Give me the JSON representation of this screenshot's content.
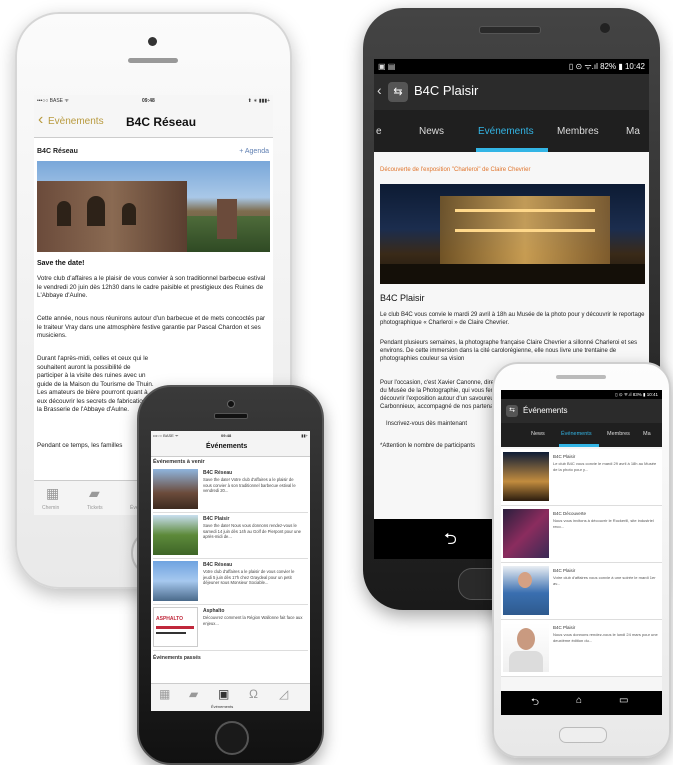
{
  "iphone_main": {
    "status": {
      "carrier": "•••○○ BASE ᯤ",
      "time": "09:48",
      "battery": "⬆ ∗ ▮▮▮+"
    },
    "nav": {
      "back_label": "Evènements",
      "title": "B4C Réseau"
    },
    "header": {
      "org": "B4C Réseau",
      "agenda": "+ Agenda"
    },
    "article": {
      "heading": "Save the date!",
      "p1": "Votre club d'affaires a le plaisir de vous convier à son traditionnel barbecue estival le vendredi 20 juin dès 12h30 dans le cadre paisible et prestigieux des Ruines de L'Abbaye d'Aulne.",
      "p2": "Cette année, nous nous réunirons autour d'un barbecue et de mets concoctés par le traiteur Vray dans une atmosphère festive garantie par Pascal Chardon et ses musiciens.",
      "p3": "Durant l'après-midi, celles et ceux qui le souhaitent auront la possibilité de participer à la visite des ruines avec un guide de la Maison du Tourisme de Thuin. Les amateurs de bière pourront quant à eux découvrir les secrets de fabrication de la Brasserie de l'Abbaye d'Aulne.",
      "p4": "Pendant ce temps, les familles"
    },
    "tabbar": {
      "tab1": "Chemin",
      "tab2": "Tickets",
      "tab3": "Évé"
    }
  },
  "android_main": {
    "status": {
      "icons": "▣ ▤",
      "right": "▯ ⊙ ᯤ.ıl 82% ▮ 10:42"
    },
    "actionbar": {
      "title": "B4C Plaisir"
    },
    "tabs": [
      "e",
      "News",
      "Evénements",
      "Membres",
      "Ma"
    ],
    "event_link": "Découverte de l'exposition \"Charleroi\" de Claire Chevrier",
    "org": "B4C Plaisir",
    "p1": "Le club B4C vous convie le mardi 29 avril à 18h au Musée de la photo pour y découvrir le reportage photographique « Charleroi » de Claire Chevrier.",
    "p2": "Pendant plusieurs semaines, la photographe française Claire Chevrier a sillonné Charleroi et ses environs. De cette immersion dans la cité carolorégienne, elle nous livre une trentaine de photographies couleur sa vision",
    "p3": "Pour l'occasion, c'est Xavier Canonne, directeur du Musée de la Photographie, qui vous fera découvrir l'exposition autour d'un savoureux Carbonnieux, accompagné de nos partenaires et de fromages proposés par le",
    "p4": "Inscrivez-vous dès maintenant",
    "p5": "*Attention le nombre de participants"
  },
  "iphone_small": {
    "status": {
      "carrier": "•••○○ BASE ᯤ",
      "time": "09:48",
      "battery": "▮▮+"
    },
    "title": "Événements",
    "section": "Événements à venir",
    "items": [
      {
        "title": "B4C Réseau",
        "desc": "Save the date! Votre club d'affaires a le plaisir de vous convier à son traditionnel barbecue estival le vendredi 20..."
      },
      {
        "title": "B4C Plaisir",
        "desc": "Save the date! Nous vous donnons rendez-vous le samedi 14 juin dès 14h au Golf de Pierpont pour une après-midi de..."
      },
      {
        "title": "B4C Réseau",
        "desc": "Votre club d'affaires a le plaisir de vous convier le jeudi 5 juin dès 17h chez Graydeal pour un petit déjeuner sous Monsieur Sociable..."
      },
      {
        "title": "Asphalto",
        "desc": "Découvrez comment la Région Wallonne fait face aux enjeux...",
        "thumb_text": "ASPHALTO"
      }
    ],
    "section_past": "Événements passés",
    "tab_active": "Événements"
  },
  "android_small": {
    "status": "▯ ⊙ ᯤ.ıl 83% ▮ 10:41",
    "title": "Événements",
    "tabs": [
      "News",
      "Événements",
      "Membres",
      "Ma"
    ],
    "items": [
      {
        "title": "B4C Plaisir",
        "desc": "Le club B4C vous convie le mardi 29 avril à 18h au Musée de la photo pour y..."
      },
      {
        "title": "B4C Découverte",
        "desc": "Nous vous invitons à découvrir le Rockerill, site industriel reco..."
      },
      {
        "title": "B4C Plaisir",
        "desc": "Votre club d'affaires vous convie à une soirée le mardi 1er av..."
      },
      {
        "title": "B4C Plaisir",
        "desc": "Nous vous donnons rendez-vous le lundi 24 mars pour une deuxième édition du..."
      }
    ]
  },
  "colors": {
    "gold": "#b89a3e",
    "android_blue": "#33b5e5",
    "orange_link": "#e0742b",
    "dark_bar": "#222222"
  }
}
